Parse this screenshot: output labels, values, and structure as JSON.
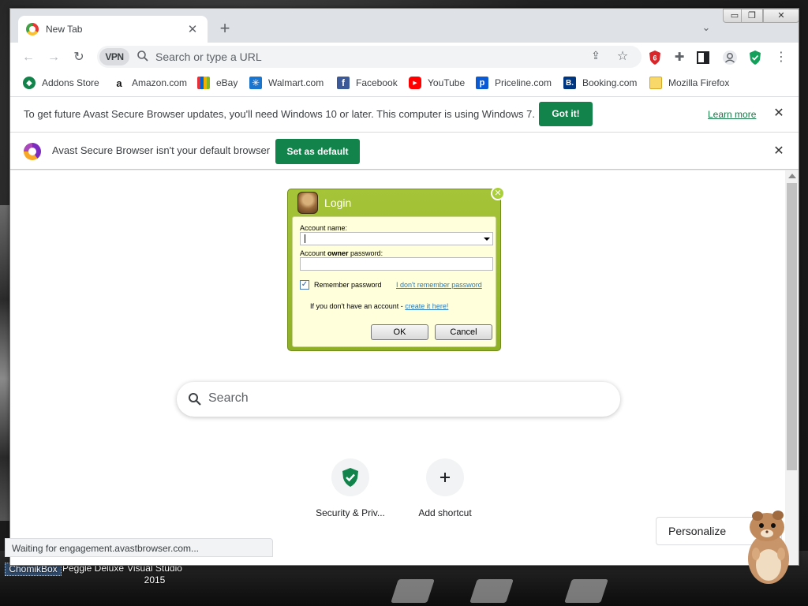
{
  "desktop": {
    "icons": [
      {
        "label": "ChomikBox"
      },
      {
        "label": "Peggle Deluxe"
      },
      {
        "label": "Visual Studio\n2015"
      }
    ]
  },
  "browser": {
    "tab": {
      "title": "New Tab"
    },
    "window_controls": {
      "minimize": "▭",
      "maximize": "❐",
      "close": "✕"
    },
    "toolbar": {
      "vpn_label": "VPN",
      "omnibox_placeholder": "Search or type a URL"
    },
    "bookmarks": [
      {
        "label": "Addons Store",
        "icon": "addons-store-icon",
        "color": "#12834a"
      },
      {
        "label": "Amazon.com",
        "icon": "amazon-icon",
        "color": "#111111"
      },
      {
        "label": "eBay",
        "icon": "ebay-icon",
        "color": "#e53238"
      },
      {
        "label": "Walmart.com",
        "icon": "walmart-icon",
        "color": "#1a75cf"
      },
      {
        "label": "Facebook",
        "icon": "facebook-icon",
        "color": "#3b5998"
      },
      {
        "label": "YouTube",
        "icon": "youtube-icon",
        "color": "#ff0000"
      },
      {
        "label": "Priceline.com",
        "icon": "priceline-icon",
        "color": "#0a5ad4"
      },
      {
        "label": "Booking.com",
        "icon": "booking-icon",
        "color": "#003580"
      },
      {
        "label": "Mozilla Firefox",
        "icon": "folder-icon",
        "color": "#f9d86a"
      }
    ],
    "infobar_update": {
      "text": "To get future Avast Secure Browser updates, you'll need Windows 10 or later. This computer is using Windows 7.",
      "button": "Got it!",
      "link": "Learn more"
    },
    "infobar_default": {
      "text": "Avast Secure Browser isn't your default browser",
      "button": "Set as default"
    },
    "new_tab": {
      "search_placeholder": "Search",
      "shortcuts": [
        {
          "label": "Security & Priv...",
          "icon": "shield-check-icon"
        },
        {
          "label": "Add shortcut",
          "icon": "plus-icon"
        }
      ],
      "personalize_label": "Personalize"
    },
    "status_text": "Waiting for engagement.avastbrowser.com..."
  },
  "login_dialog": {
    "title": "Login",
    "account_name_label": "Account name:",
    "password_label_pre": "Account ",
    "password_label_bold": "owner",
    "password_label_post": " password:",
    "account_name_value": "",
    "password_value": "",
    "remember_label": "Remember password",
    "remember_checked": true,
    "forgot_link": "I don't remember password",
    "no_account_text": "If you don't have an account - ",
    "create_link": "create it here!",
    "ok_label": "OK",
    "cancel_label": "Cancel"
  },
  "colors": {
    "accent_green": "#12834a",
    "dialog_green": "#9bbd2e"
  }
}
